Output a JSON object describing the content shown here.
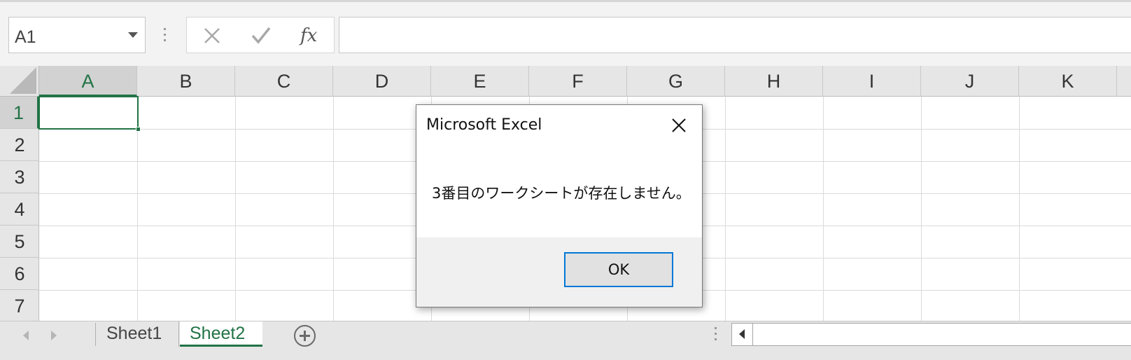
{
  "formula_bar": {
    "name_box_value": "A1",
    "formula_value": ""
  },
  "columns": [
    "A",
    "B",
    "C",
    "D",
    "E",
    "F",
    "G",
    "H",
    "I",
    "J",
    "K"
  ],
  "rows": [
    "1",
    "2",
    "3",
    "4",
    "5",
    "6",
    "7"
  ],
  "active_cell": "A1",
  "sheet_tabs": {
    "sheet1": "Sheet1",
    "sheet2": "Sheet2",
    "active": "Sheet2"
  },
  "dialog": {
    "title": "Microsoft Excel",
    "message": "3番目のワークシートが存在しません。",
    "ok_label": "OK"
  },
  "colors": {
    "accent": "#217346",
    "dialog_focus": "#0078d7"
  },
  "icons": {
    "cancel": "close-icon",
    "enter": "check-icon",
    "function": "fx-icon",
    "dialog_close": "close-icon",
    "add_sheet": "plus-circle-icon"
  }
}
